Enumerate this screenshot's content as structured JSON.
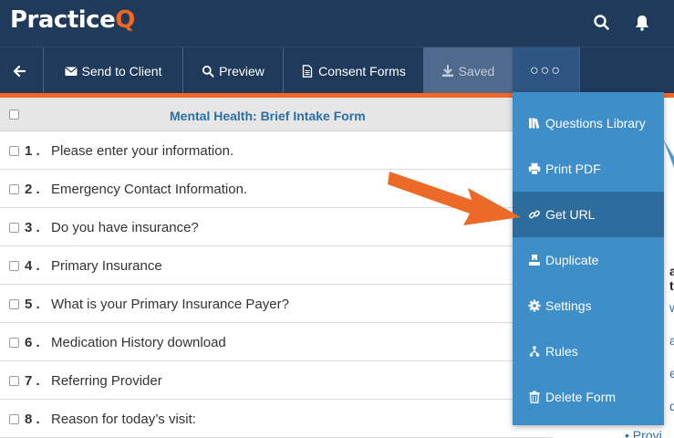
{
  "header": {
    "logo_main": "Practice",
    "logo_accent": "Q",
    "icons": [
      "search-icon",
      "bell-icon"
    ]
  },
  "toolbar": {
    "back_icon": "arrow-left-icon",
    "send_label": "Send to Client",
    "preview_label": "Preview",
    "consent_label": "Consent Forms",
    "saved_label": "Saved",
    "more_label": "○○○"
  },
  "form": {
    "title": "Mental Health: Brief Intake Form",
    "questions": [
      {
        "num": "1 .",
        "text": "Please enter your information."
      },
      {
        "num": "2 .",
        "text": "Emergency Contact Information."
      },
      {
        "num": "3 .",
        "text": "Do you have insurance?"
      },
      {
        "num": "4 .",
        "text": "Primary Insurance"
      },
      {
        "num": "5 .",
        "text": "What is your Primary Insurance Payer?"
      },
      {
        "num": "6 .",
        "text": "Medication History download"
      },
      {
        "num": "7 .",
        "text": "Referring Provider"
      },
      {
        "num": "8 .",
        "text": "Reason for today’s visit:"
      }
    ]
  },
  "menu": {
    "items": [
      {
        "label": "Questions Library",
        "icon": "books-icon"
      },
      {
        "label": "Print PDF",
        "icon": "print-icon"
      },
      {
        "label": "Get URL",
        "icon": "link-icon"
      },
      {
        "label": "Duplicate",
        "icon": "duplicate-icon"
      },
      {
        "label": "Settings",
        "icon": "gear-icon"
      },
      {
        "label": "Rules",
        "icon": "rules-icon"
      },
      {
        "label": "Delete Form",
        "icon": "trash-icon"
      }
    ],
    "active_index": 2
  },
  "background_fragments": {
    "a": "a t",
    "b": "w",
    "c": "a",
    "d": "e",
    "e": "d",
    "f": "Provi"
  },
  "colors": {
    "header_bg": "#1f3a5a",
    "accent_orange": "#f26722",
    "menu_bg": "#3d8ec9",
    "menu_active": "#2d6d9e",
    "title_blue": "#2a6fa8"
  }
}
